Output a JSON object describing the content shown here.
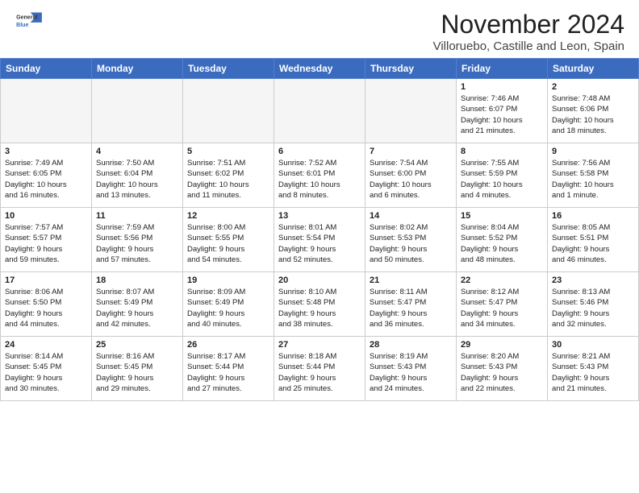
{
  "header": {
    "logo_line1": "General",
    "logo_line2": "Blue",
    "month": "November 2024",
    "location": "Villoruebo, Castille and Leon, Spain"
  },
  "weekdays": [
    "Sunday",
    "Monday",
    "Tuesday",
    "Wednesday",
    "Thursday",
    "Friday",
    "Saturday"
  ],
  "weeks": [
    [
      {
        "day": "",
        "info": ""
      },
      {
        "day": "",
        "info": ""
      },
      {
        "day": "",
        "info": ""
      },
      {
        "day": "",
        "info": ""
      },
      {
        "day": "",
        "info": ""
      },
      {
        "day": "1",
        "info": "Sunrise: 7:46 AM\nSunset: 6:07 PM\nDaylight: 10 hours\nand 21 minutes."
      },
      {
        "day": "2",
        "info": "Sunrise: 7:48 AM\nSunset: 6:06 PM\nDaylight: 10 hours\nand 18 minutes."
      }
    ],
    [
      {
        "day": "3",
        "info": "Sunrise: 7:49 AM\nSunset: 6:05 PM\nDaylight: 10 hours\nand 16 minutes."
      },
      {
        "day": "4",
        "info": "Sunrise: 7:50 AM\nSunset: 6:04 PM\nDaylight: 10 hours\nand 13 minutes."
      },
      {
        "day": "5",
        "info": "Sunrise: 7:51 AM\nSunset: 6:02 PM\nDaylight: 10 hours\nand 11 minutes."
      },
      {
        "day": "6",
        "info": "Sunrise: 7:52 AM\nSunset: 6:01 PM\nDaylight: 10 hours\nand 8 minutes."
      },
      {
        "day": "7",
        "info": "Sunrise: 7:54 AM\nSunset: 6:00 PM\nDaylight: 10 hours\nand 6 minutes."
      },
      {
        "day": "8",
        "info": "Sunrise: 7:55 AM\nSunset: 5:59 PM\nDaylight: 10 hours\nand 4 minutes."
      },
      {
        "day": "9",
        "info": "Sunrise: 7:56 AM\nSunset: 5:58 PM\nDaylight: 10 hours\nand 1 minute."
      }
    ],
    [
      {
        "day": "10",
        "info": "Sunrise: 7:57 AM\nSunset: 5:57 PM\nDaylight: 9 hours\nand 59 minutes."
      },
      {
        "day": "11",
        "info": "Sunrise: 7:59 AM\nSunset: 5:56 PM\nDaylight: 9 hours\nand 57 minutes."
      },
      {
        "day": "12",
        "info": "Sunrise: 8:00 AM\nSunset: 5:55 PM\nDaylight: 9 hours\nand 54 minutes."
      },
      {
        "day": "13",
        "info": "Sunrise: 8:01 AM\nSunset: 5:54 PM\nDaylight: 9 hours\nand 52 minutes."
      },
      {
        "day": "14",
        "info": "Sunrise: 8:02 AM\nSunset: 5:53 PM\nDaylight: 9 hours\nand 50 minutes."
      },
      {
        "day": "15",
        "info": "Sunrise: 8:04 AM\nSunset: 5:52 PM\nDaylight: 9 hours\nand 48 minutes."
      },
      {
        "day": "16",
        "info": "Sunrise: 8:05 AM\nSunset: 5:51 PM\nDaylight: 9 hours\nand 46 minutes."
      }
    ],
    [
      {
        "day": "17",
        "info": "Sunrise: 8:06 AM\nSunset: 5:50 PM\nDaylight: 9 hours\nand 44 minutes."
      },
      {
        "day": "18",
        "info": "Sunrise: 8:07 AM\nSunset: 5:49 PM\nDaylight: 9 hours\nand 42 minutes."
      },
      {
        "day": "19",
        "info": "Sunrise: 8:09 AM\nSunset: 5:49 PM\nDaylight: 9 hours\nand 40 minutes."
      },
      {
        "day": "20",
        "info": "Sunrise: 8:10 AM\nSunset: 5:48 PM\nDaylight: 9 hours\nand 38 minutes."
      },
      {
        "day": "21",
        "info": "Sunrise: 8:11 AM\nSunset: 5:47 PM\nDaylight: 9 hours\nand 36 minutes."
      },
      {
        "day": "22",
        "info": "Sunrise: 8:12 AM\nSunset: 5:47 PM\nDaylight: 9 hours\nand 34 minutes."
      },
      {
        "day": "23",
        "info": "Sunrise: 8:13 AM\nSunset: 5:46 PM\nDaylight: 9 hours\nand 32 minutes."
      }
    ],
    [
      {
        "day": "24",
        "info": "Sunrise: 8:14 AM\nSunset: 5:45 PM\nDaylight: 9 hours\nand 30 minutes."
      },
      {
        "day": "25",
        "info": "Sunrise: 8:16 AM\nSunset: 5:45 PM\nDaylight: 9 hours\nand 29 minutes."
      },
      {
        "day": "26",
        "info": "Sunrise: 8:17 AM\nSunset: 5:44 PM\nDaylight: 9 hours\nand 27 minutes."
      },
      {
        "day": "27",
        "info": "Sunrise: 8:18 AM\nSunset: 5:44 PM\nDaylight: 9 hours\nand 25 minutes."
      },
      {
        "day": "28",
        "info": "Sunrise: 8:19 AM\nSunset: 5:43 PM\nDaylight: 9 hours\nand 24 minutes."
      },
      {
        "day": "29",
        "info": "Sunrise: 8:20 AM\nSunset: 5:43 PM\nDaylight: 9 hours\nand 22 minutes."
      },
      {
        "day": "30",
        "info": "Sunrise: 8:21 AM\nSunset: 5:43 PM\nDaylight: 9 hours\nand 21 minutes."
      }
    ]
  ]
}
